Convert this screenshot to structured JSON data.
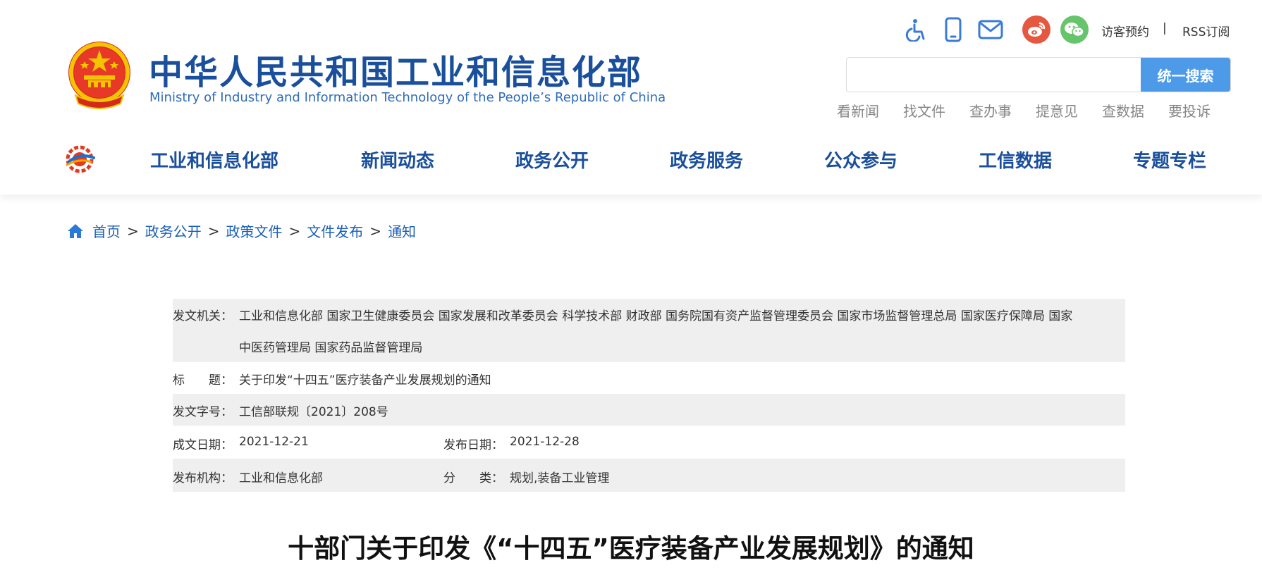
{
  "header": {
    "title": "中华人民共和国工业和信息化部",
    "subtitle": "Ministry of Industry and Information Technology of the People’s Republic of China",
    "icons": [
      "accessibility-icon",
      "mobile-icon",
      "mail-icon",
      "weibo-icon",
      "wechat-icon"
    ],
    "top_links": {
      "visitor": "访客预约",
      "separator": "|",
      "rss": "RSS订阅"
    },
    "search": {
      "placeholder": "",
      "button_label": "统一搜索"
    },
    "quick_links": [
      "看新闻",
      "找文件",
      "查办事",
      "提意见",
      "查数据",
      "要投诉"
    ],
    "colors": {
      "brand_blue": "#1a4f9c",
      "search_button": "#4d9be8",
      "weibo": "#e6573f",
      "wechat": "#66c46a"
    }
  },
  "nav": {
    "items": [
      "工业和信息化部",
      "新闻动态",
      "政务公开",
      "政务服务",
      "公众参与",
      "工信数据",
      "专题专栏"
    ]
  },
  "breadcrumb": {
    "items": [
      "首页",
      "政务公开",
      "政策文件",
      "文件发布",
      "通知"
    ],
    "separator": ">"
  },
  "meta": {
    "issuer_label": "发文机关：",
    "issuer_line1": "工业和信息化部 国家卫生健康委员会 国家发展和改革委员会 科学技术部 财政部 国务院国有资产监督管理委员会 国家市场监督管理总局 国家医疗保障局 国家",
    "issuer_line2": "中医药管理局 国家药品监督管理局",
    "title_label": "标　　题：",
    "title_value": "关于印发“十四五”医疗装备产业发展规划的通知",
    "docno_label": "发文字号：",
    "docno_value": "工信部联规〔2021〕208号",
    "written_label": "成文日期：",
    "written_value": "2021-12-21",
    "published_label": "发布日期：",
    "published_value": "2021-12-28",
    "org_label": "发布机构：",
    "org_value": "工业和信息化部",
    "category_label": "分　　类：",
    "category_value": "规划,装备工业管理"
  },
  "document": {
    "title": "十部门关于印发《“十四五”医疗装备产业发展规划》的通知"
  }
}
